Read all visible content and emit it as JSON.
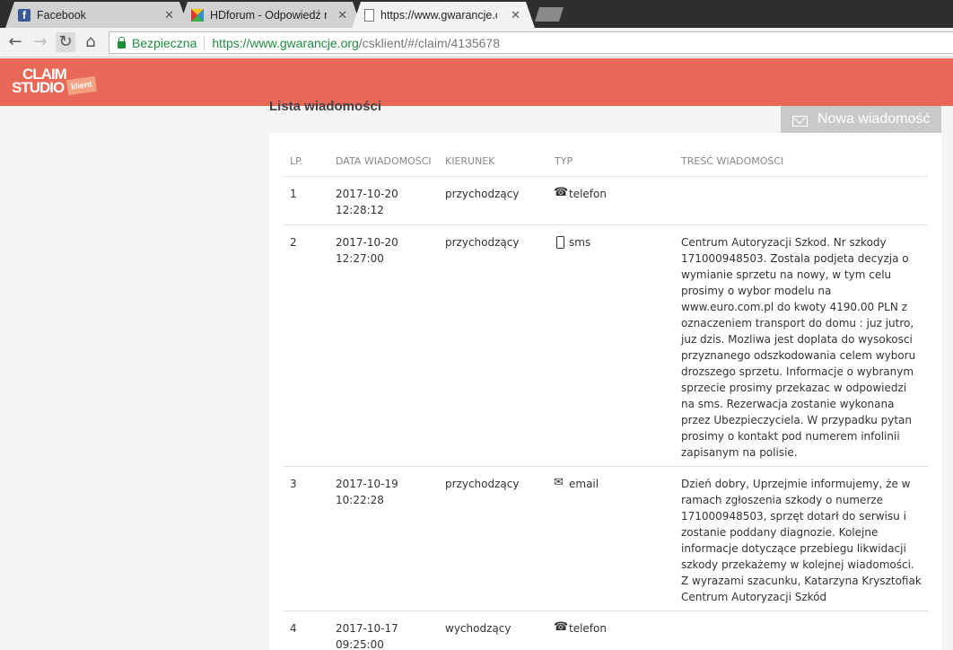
{
  "browser": {
    "tabs": [
      {
        "title": "Facebook",
        "icon": "facebook-icon"
      },
      {
        "title": "HDforum - Odpowiedź na",
        "icon": "hdforum-icon"
      },
      {
        "title": "https://www.gwarancje.c",
        "icon": "page-icon"
      }
    ],
    "security_label": "Bezpieczna",
    "url_host": "https://www.gwarancje.org",
    "url_path": "/csklient/#/claim/4135678"
  },
  "app": {
    "logo_line1": "CLAIM",
    "logo_line2": "STUDIO",
    "logo_badge": "klient",
    "brand_color": "#e86756"
  },
  "messages": {
    "section_title": "Lista wiadomości",
    "new_message_label": "Nowa wiadomość",
    "columns": {
      "lp": "LP.",
      "date": "DATA WIADOMOŚCI",
      "direction": "KIERUNEK",
      "type": "TYP",
      "body": "TREŚĆ WIADOMOŚCI"
    },
    "rows": [
      {
        "lp": "1",
        "date": "2017-10-20",
        "time": "12:28:12",
        "direction": "przychodzący",
        "type": "telefon",
        "type_icon": "phone-icon",
        "body": ""
      },
      {
        "lp": "2",
        "date": "2017-10-20",
        "time": "12:27:00",
        "direction": "przychodzący",
        "type": "sms",
        "type_icon": "mobile-icon",
        "body": "Centrum Autoryzacji Szkod. Nr szkody 171000948503. Zostala podjeta decyzja o wymianie sprzetu na nowy, w tym celu prosimy o wybor modelu na www.euro.com.pl do kwoty 4190.00 PLN z oznaczeniem transport do domu : juz jutro, juz dzis. Mozliwa jest doplata do wysokosci przyznanego odszkodowania celem wyboru drozszego sprzetu. Informacje o wybranym sprzecie prosimy przekazac w odpowiedzi na sms. Rezerwacja zostanie wykonana przez Ubezpieczyciela. W przypadku pytan prosimy o kontakt pod numerem infolinii zapisanym na polisie."
      },
      {
        "lp": "3",
        "date": "2017-10-19",
        "time": "10:22:28",
        "direction": "przychodzący",
        "type": "email",
        "type_icon": "email-icon",
        "body": "Dzień dobry,   Uprzejmie informujemy, że w ramach zgłoszenia szkody o numerze 171000948503, sprzęt dotarł do serwisu i zostanie poddany diagnozie. Kolejne informacje dotyczące przebiegu likwidacji szkody przekażemy w kolejnej wiadomości.  Z wyrazami szacunku, Katarzyna Krysztofiak Centrum Autoryzacji Szkód"
      },
      {
        "lp": "4",
        "date": "2017-10-17",
        "time": "09:25:00",
        "direction": "wychodzący",
        "type": "telefon",
        "type_icon": "phone-icon",
        "body": ""
      }
    ]
  }
}
